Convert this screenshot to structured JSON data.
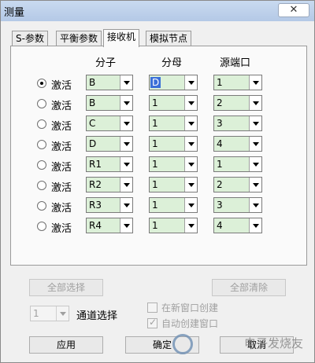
{
  "window": {
    "title": "测量",
    "close_icon": "close-icon"
  },
  "tabs": [
    {
      "label": "S-参数"
    },
    {
      "label": "平衡参数"
    },
    {
      "label": "接收机",
      "active": true
    },
    {
      "label": "模拟节点"
    }
  ],
  "columns": {
    "numerator": "分子",
    "denominator": "分母",
    "source_port": "源端口"
  },
  "rows": [
    {
      "label": "激活",
      "selected": true,
      "numerator": "B",
      "denominator": "D",
      "source_port": "1"
    },
    {
      "label": "激活",
      "selected": false,
      "numerator": "B",
      "denominator": "1",
      "source_port": "2"
    },
    {
      "label": "激活",
      "selected": false,
      "numerator": "C",
      "denominator": "1",
      "source_port": "3"
    },
    {
      "label": "激活",
      "selected": false,
      "numerator": "D",
      "denominator": "1",
      "source_port": "4"
    },
    {
      "label": "激活",
      "selected": false,
      "numerator": "R1",
      "denominator": "1",
      "source_port": "1"
    },
    {
      "label": "激活",
      "selected": false,
      "numerator": "R2",
      "denominator": "1",
      "source_port": "2"
    },
    {
      "label": "激活",
      "selected": false,
      "numerator": "R3",
      "denominator": "1",
      "source_port": "3"
    },
    {
      "label": "激活",
      "selected": false,
      "numerator": "R4",
      "denominator": "1",
      "source_port": "4"
    }
  ],
  "buttons": {
    "select_all": "全部选择",
    "clear_all": "全部清除",
    "apply": "应用",
    "ok": "确定",
    "cancel": "取消"
  },
  "channel": {
    "value": "1",
    "label": "通道选择"
  },
  "options": {
    "new_window": "在新窗口创建",
    "auto_create": "自动创建窗口"
  },
  "watermark": "电子发烧友",
  "colors": {
    "field_green": "#dcf0d8",
    "selection_blue": "#3a6fd8"
  }
}
